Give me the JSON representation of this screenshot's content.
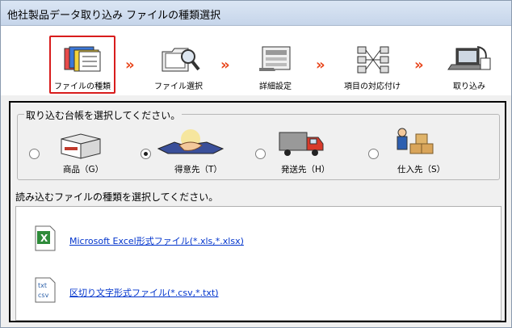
{
  "window": {
    "title": "他社製品データ取り込み ファイルの種類選択"
  },
  "wizard": {
    "arrow": "»",
    "steps": [
      {
        "label": "ファイルの種類",
        "active": true
      },
      {
        "label": "ファイル選択",
        "active": false
      },
      {
        "label": "詳細設定",
        "active": false
      },
      {
        "label": "項目の対応付け",
        "active": false
      },
      {
        "label": "取り込み",
        "active": false
      }
    ]
  },
  "ledger": {
    "prompt": "取り込む台帳を選択してください。",
    "options": [
      {
        "label": "商品（G）",
        "checked": false,
        "icon": "box-icon"
      },
      {
        "label": "得意先（T）",
        "checked": true,
        "icon": "handshake-icon"
      },
      {
        "label": "発送先（H）",
        "checked": false,
        "icon": "truck-icon"
      },
      {
        "label": "仕入先（S）",
        "checked": false,
        "icon": "worker-boxes-icon"
      }
    ]
  },
  "filetype": {
    "prompt": "読み込むファイルの種類を選択してください。",
    "items": [
      {
        "label": "Microsoft Excel形式ファイル(*.xls,*.xlsx)",
        "icon": "excel-file-icon"
      },
      {
        "label": "区切り文字形式ファイル(*.csv,*.txt)",
        "icon": "txt-csv-file-icon"
      }
    ]
  },
  "colors": {
    "accent_red": "#d81c1c",
    "arrow_orange": "#e8461c",
    "link_blue": "#0033cc"
  }
}
